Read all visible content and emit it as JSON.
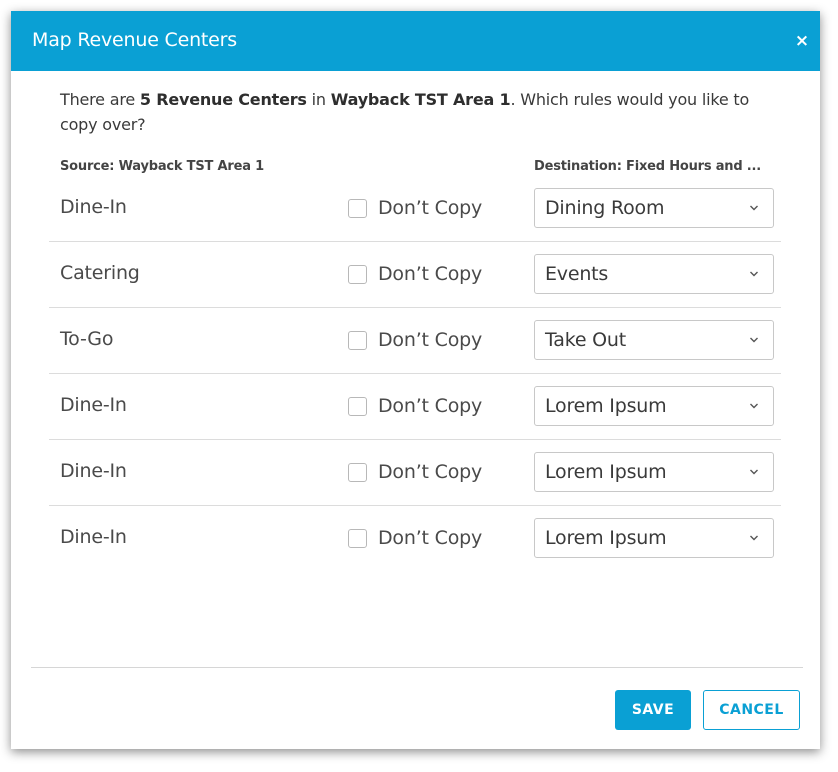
{
  "dialog": {
    "title": "Map Revenue Centers",
    "close_glyph": "×"
  },
  "intro": {
    "prefix": "There are ",
    "count_text": "5 Revenue Centers",
    "middle": " in ",
    "area": "Wayback TST Area 1",
    "suffix": ". Which rules would you like to copy over?"
  },
  "columns": {
    "source": "Source: Wayback TST Area 1",
    "destination": "Destination: Fixed Hours and ..."
  },
  "rows": [
    {
      "source": "Dine-In",
      "dont_copy_label": "Don’t Copy",
      "checked": false,
      "destination": "Dining Room"
    },
    {
      "source": "Catering",
      "dont_copy_label": "Don’t Copy",
      "checked": false,
      "destination": "Events"
    },
    {
      "source": "To-Go",
      "dont_copy_label": "Don’t Copy",
      "checked": false,
      "destination": "Take Out"
    },
    {
      "source": "Dine-In",
      "dont_copy_label": "Don’t Copy",
      "checked": false,
      "destination": "Lorem Ipsum"
    },
    {
      "source": "Dine-In",
      "dont_copy_label": "Don’t Copy",
      "checked": false,
      "destination": "Lorem Ipsum"
    },
    {
      "source": "Dine-In",
      "dont_copy_label": "Don’t Copy",
      "checked": false,
      "destination": "Lorem Ipsum"
    }
  ],
  "footer": {
    "save_label": "SAVE",
    "cancel_label": "CANCEL"
  },
  "icons": {
    "close": "close-icon",
    "dropdown": "chevron-down-icon"
  },
  "colors": {
    "accent": "#0aa0d4",
    "text": "#4a4a4a",
    "divider": "#dcdcdc"
  }
}
